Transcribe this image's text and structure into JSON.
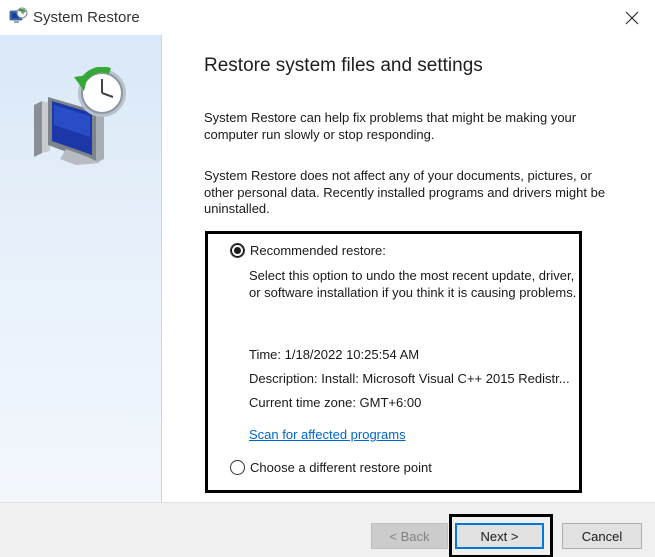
{
  "window": {
    "title": "System Restore",
    "app_icon": "system-restore-icon",
    "close_icon": "close-icon"
  },
  "sidebar": {
    "icon": "computer-clock-restore-icon"
  },
  "main": {
    "heading": "Restore system files and settings",
    "paragraph1": "System Restore can help fix problems that might be making your computer run slowly or stop responding.",
    "paragraph2": "System Restore does not affect any of your documents, pictures, or other personal data. Recently installed programs and drivers might be uninstalled."
  },
  "options": {
    "recommended": {
      "label": "Recommended restore:",
      "selected": true,
      "description": "Select this option to undo the most recent update, driver, or software installation if you think it is causing problems.",
      "time": "Time: 1/18/2022 10:25:54 AM",
      "description_line": "Description: Install: Microsoft Visual C++ 2015 Redistr...",
      "timezone": "Current time zone: GMT+6:00",
      "scan_link": "Scan for affected programs"
    },
    "different": {
      "label": "Choose a different restore point",
      "selected": false
    }
  },
  "footer": {
    "back_label": "< Back",
    "back_enabled": false,
    "next_label": "Next >",
    "cancel_label": "Cancel"
  },
  "colors": {
    "accent": "#0078d7",
    "link": "#0066cc",
    "highlight_outline": "#000000"
  }
}
